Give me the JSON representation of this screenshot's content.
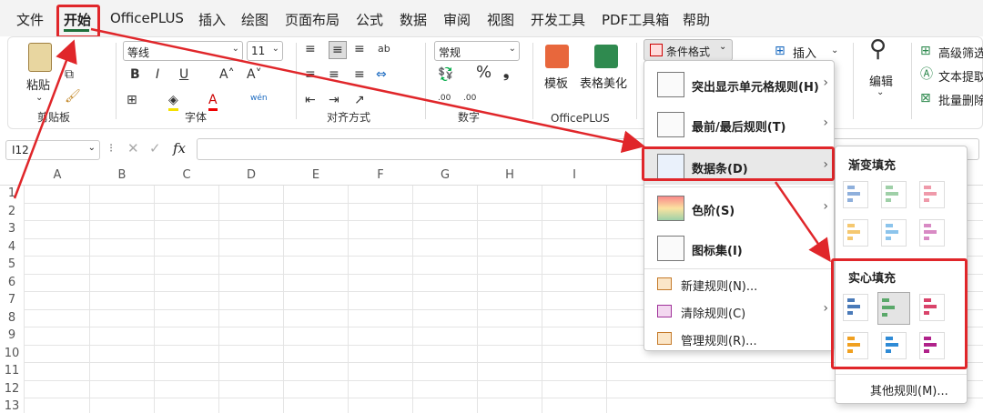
{
  "menu": {
    "items": [
      "文件",
      "开始",
      "OfficePLUS",
      "插入",
      "绘图",
      "页面布局",
      "公式",
      "数据",
      "审阅",
      "视图",
      "开发工具",
      "PDF工具箱",
      "帮助"
    ]
  },
  "ribbon": {
    "clipboard": {
      "paste": "粘贴",
      "group": "剪贴板"
    },
    "font": {
      "name": "等线",
      "size": "11",
      "group": "字体"
    },
    "align": {
      "group": "对齐方式"
    },
    "number": {
      "format": "常规",
      "group": "数字"
    },
    "officeplus": {
      "template": "模板",
      "beautify": "表格美化",
      "group": "OfficePLUS"
    },
    "cond_format": "条件格式",
    "insert": "插入",
    "edit": "编辑",
    "right": {
      "adv_filter": "高级筛选",
      "text_extract": "文本提取",
      "batch_delete": "批量删除"
    }
  },
  "formula_bar": {
    "cell": "I12",
    "fx": "fx"
  },
  "grid": {
    "columns": [
      "A",
      "B",
      "C",
      "D",
      "E",
      "F",
      "G",
      "H",
      "I"
    ],
    "rows": [
      "1",
      "2",
      "3",
      "4",
      "5",
      "6",
      "7",
      "8",
      "9",
      "10",
      "11",
      "12",
      "13"
    ]
  },
  "dropdown": {
    "items": [
      {
        "label": "突出显示单元格规则(H)"
      },
      {
        "label": "最前/最后规则(T)"
      },
      {
        "label": "数据条(D)"
      },
      {
        "label": "色阶(S)"
      },
      {
        "label": "图标集(I)"
      },
      {
        "label": "新建规则(N)..."
      },
      {
        "label": "清除规则(C)"
      },
      {
        "label": "管理规则(R)..."
      }
    ]
  },
  "submenu": {
    "gradient": "渐变填充",
    "solid": "实心填充",
    "more": "其他规则(M)..."
  },
  "colors": {
    "red": "#e0262a",
    "blue": "#4a7ab8",
    "green": "#5aa86a",
    "pink": "#d9436a",
    "orange": "#f0a020",
    "cyan": "#2f8bd6",
    "magenta": "#b0228a"
  }
}
